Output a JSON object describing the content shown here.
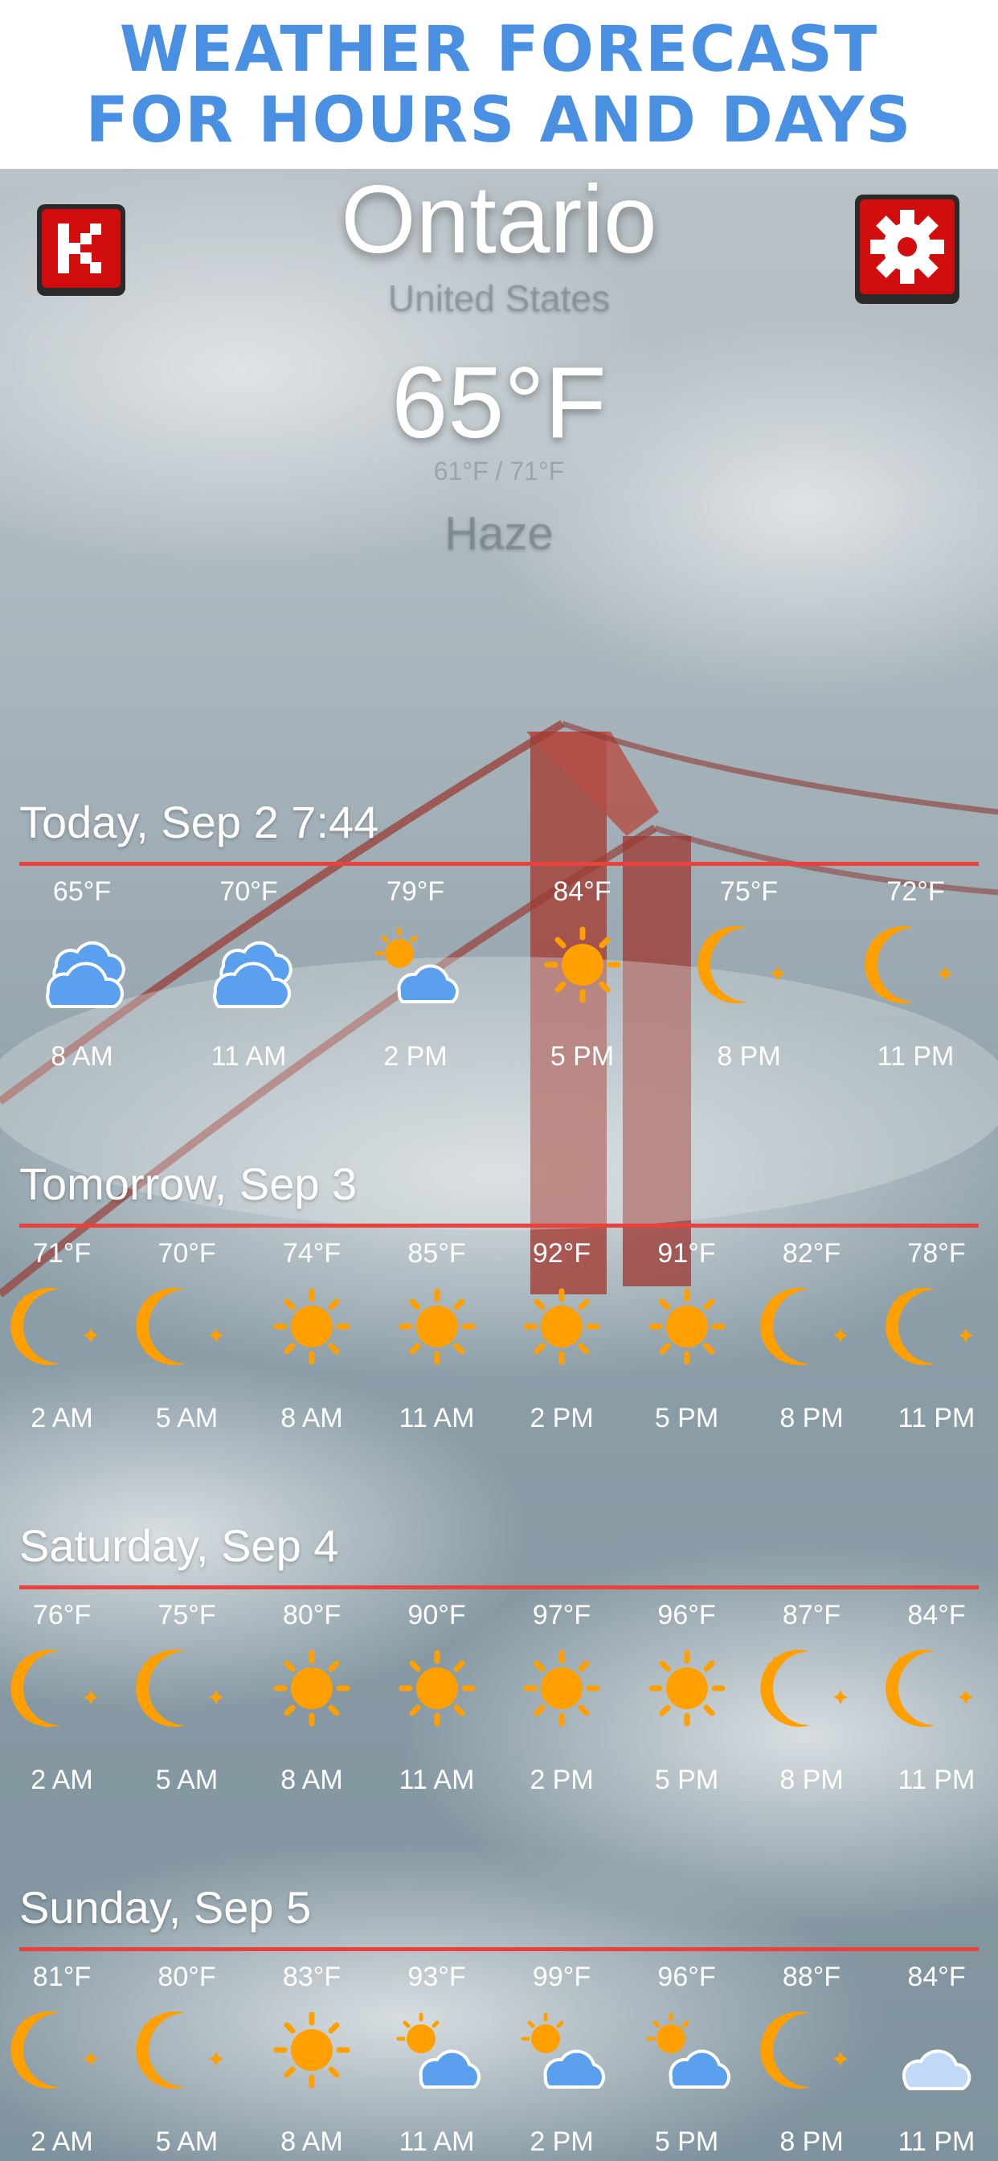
{
  "promo": {
    "line1": "WEATHER FORECAST",
    "line2": "FOR HOURS AND DAYS"
  },
  "header": {
    "logo_icon": "k-logo-icon",
    "settings_icon": "gear-icon",
    "city": "Ontario",
    "country": "United States",
    "temperature": "65°F",
    "range": "61°F / 71°F",
    "condition": "Haze"
  },
  "colors": {
    "rule": "#e9423d",
    "sun": "#ffa000",
    "cloud": "#5aa0ee",
    "promo": "#4a90e2"
  },
  "days": [
    {
      "title": "Today, Sep 2 7:44",
      "hours": [
        {
          "temp": "65°F",
          "icon": "cloud",
          "time": "8 AM"
        },
        {
          "temp": "70°F",
          "icon": "cloud",
          "time": "11 AM"
        },
        {
          "temp": "79°F",
          "icon": "sun-cloud",
          "time": "2 PM"
        },
        {
          "temp": "84°F",
          "icon": "sun",
          "time": "5 PM"
        },
        {
          "temp": "75°F",
          "icon": "moon",
          "time": "8 PM"
        },
        {
          "temp": "72°F",
          "icon": "moon",
          "time": "11 PM"
        }
      ]
    },
    {
      "title": "Tomorrow, Sep 3",
      "hours": [
        {
          "temp": "71°F",
          "icon": "moon",
          "time": "2 AM"
        },
        {
          "temp": "70°F",
          "icon": "moon",
          "time": "5 AM"
        },
        {
          "temp": "74°F",
          "icon": "sun",
          "time": "8 AM"
        },
        {
          "temp": "85°F",
          "icon": "sun",
          "time": "11 AM"
        },
        {
          "temp": "92°F",
          "icon": "sun",
          "time": "2 PM"
        },
        {
          "temp": "91°F",
          "icon": "sun",
          "time": "5 PM"
        },
        {
          "temp": "82°F",
          "icon": "moon",
          "time": "8 PM"
        },
        {
          "temp": "78°F",
          "icon": "moon",
          "time": "11 PM"
        }
      ]
    },
    {
      "title": "Saturday, Sep 4",
      "hours": [
        {
          "temp": "76°F",
          "icon": "moon",
          "time": "2 AM"
        },
        {
          "temp": "75°F",
          "icon": "moon",
          "time": "5 AM"
        },
        {
          "temp": "80°F",
          "icon": "sun",
          "time": "8 AM"
        },
        {
          "temp": "90°F",
          "icon": "sun",
          "time": "11 AM"
        },
        {
          "temp": "97°F",
          "icon": "sun",
          "time": "2 PM"
        },
        {
          "temp": "96°F",
          "icon": "sun",
          "time": "5 PM"
        },
        {
          "temp": "87°F",
          "icon": "moon",
          "time": "8 PM"
        },
        {
          "temp": "84°F",
          "icon": "moon",
          "time": "11 PM"
        }
      ]
    },
    {
      "title": "Sunday, Sep 5",
      "hours": [
        {
          "temp": "81°F",
          "icon": "moon",
          "time": "2 AM"
        },
        {
          "temp": "80°F",
          "icon": "moon",
          "time": "5 AM"
        },
        {
          "temp": "83°F",
          "icon": "sun",
          "time": "8 AM"
        },
        {
          "temp": "93°F",
          "icon": "sun-cloud",
          "time": "11 AM"
        },
        {
          "temp": "99°F",
          "icon": "sun-cloud",
          "time": "2 PM"
        },
        {
          "temp": "96°F",
          "icon": "sun-cloud",
          "time": "5 PM"
        },
        {
          "temp": "88°F",
          "icon": "moon",
          "time": "8 PM"
        },
        {
          "temp": "84°F",
          "icon": "moon-cloud",
          "time": "11 PM"
        }
      ]
    }
  ]
}
